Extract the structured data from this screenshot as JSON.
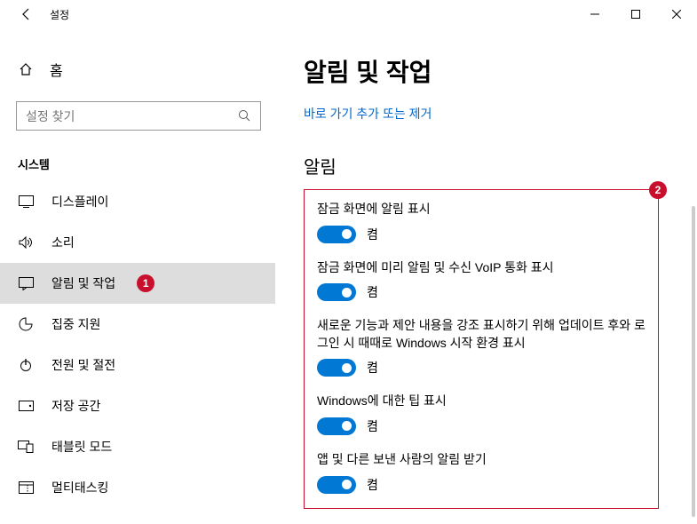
{
  "window": {
    "title": "설정"
  },
  "sidebar": {
    "home": "홈",
    "search_placeholder": "설정 찾기",
    "group": "시스템",
    "items": [
      {
        "label": "디스플레이"
      },
      {
        "label": "소리"
      },
      {
        "label": "알림 및 작업"
      },
      {
        "label": "집중 지원"
      },
      {
        "label": "전원 및 절전"
      },
      {
        "label": "저장 공간"
      },
      {
        "label": "태블릿 모드"
      },
      {
        "label": "멀티태스킹"
      }
    ],
    "badge1": "1"
  },
  "page": {
    "title": "알림 및 작업",
    "quick_link": "바로 가기 추가 또는 제거",
    "section": "알림",
    "badge2": "2",
    "settings": [
      {
        "label": "잠금 화면에 알림 표시",
        "state": "켬"
      },
      {
        "label": "잠금 화면에 미리 알림 및 수신 VoIP 통화 표시",
        "state": "켬"
      },
      {
        "label": "새로운 기능과 제안 내용을 강조 표시하기 위해 업데이트 후와 로그인 시 때때로 Windows 시작 환경 표시",
        "state": "켬"
      },
      {
        "label": "Windows에 대한 팁 표시",
        "state": "켬"
      },
      {
        "label": "앱 및 다른 보낸 사람의 알림 받기",
        "state": "켬"
      }
    ]
  }
}
